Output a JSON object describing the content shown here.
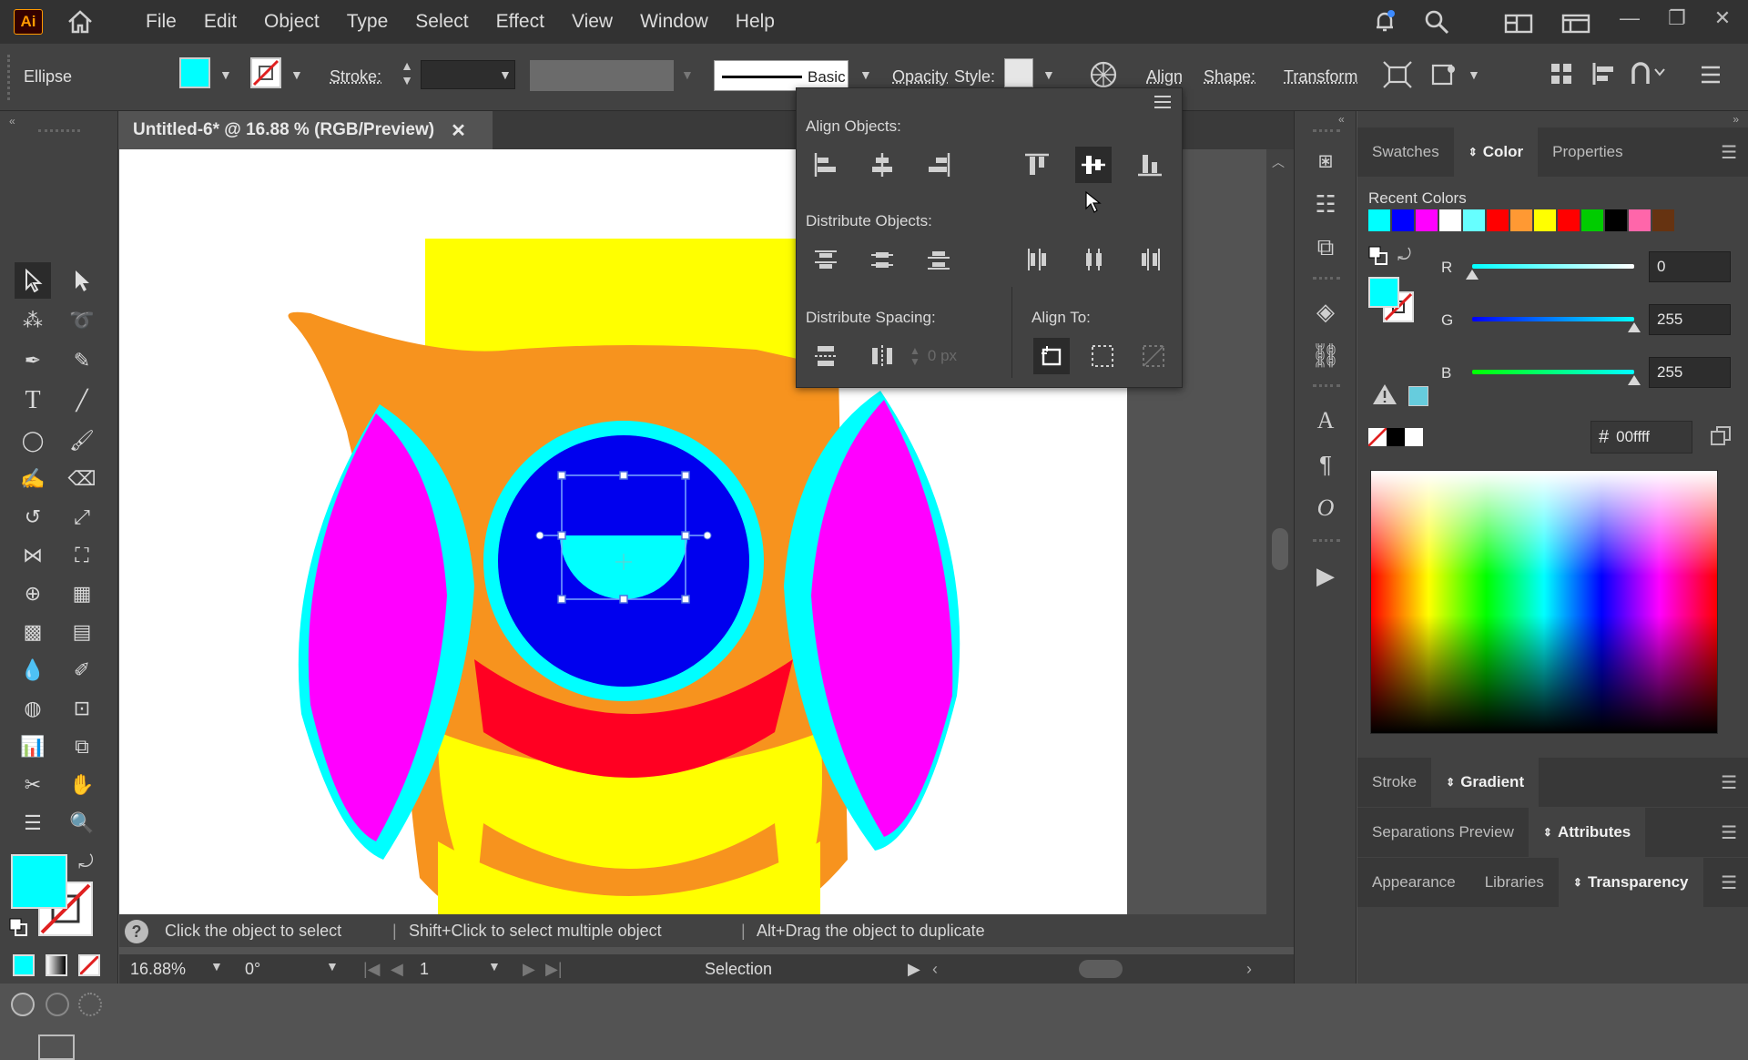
{
  "app": {
    "logo_text": "Ai"
  },
  "menu": [
    "File",
    "Edit",
    "Object",
    "Type",
    "Select",
    "Effect",
    "View",
    "Window",
    "Help"
  ],
  "control_bar": {
    "selection_type": "Ellipse",
    "stroke_label": "Stroke:",
    "brush_label": "Basic",
    "opacity_label": "Opacity",
    "style_label": "Style:",
    "align_label": "Align",
    "shape_label": "Shape:",
    "transform_label": "Transform",
    "fill_color": "#00ffff"
  },
  "document": {
    "tab_title": "Untitled-6* @ 16.88 % (RGB/Preview)",
    "close": "✕"
  },
  "align_panel": {
    "align_objects_label": "Align Objects:",
    "distribute_objects_label": "Distribute Objects:",
    "distribute_spacing_label": "Distribute Spacing:",
    "align_to_label": "Align To:",
    "spacing_value": "0 px"
  },
  "status": {
    "hint_1": "Click the object to select",
    "hint_2": "Shift+Click to select multiple object",
    "hint_3": "Alt+Drag the object to duplicate",
    "zoom": "16.88%",
    "rotation": "0°",
    "artboard": "1",
    "tool": "Selection"
  },
  "color_panel": {
    "tabs": [
      "Swatches",
      "Color",
      "Properties"
    ],
    "active_tab": "Color",
    "recent_colors_label": "Recent Colors",
    "recent_colors": [
      "#00ffff",
      "#0000ff",
      "#ff00ff",
      "#ffffff",
      "#66ffff",
      "#ff0000",
      "#ff9933",
      "#ffff00",
      "#ff0000",
      "#00cc00",
      "#000000",
      "#ff66aa",
      "#663311"
    ],
    "r_label": "R",
    "r_value": "0",
    "r_fraction": 0.0,
    "g_label": "G",
    "g_value": "255",
    "g_fraction": 1.0,
    "b_label": "B",
    "b_value": "255",
    "b_fraction": 1.0,
    "hex_symbol": "#",
    "hex_value": "00ffff"
  },
  "panels": {
    "row1": [
      "Stroke",
      "Gradient"
    ],
    "row1_active": "Gradient",
    "row2": [
      "Separations Preview",
      "Attributes"
    ],
    "row2_active": "Attributes",
    "row3": [
      "Appearance",
      "Libraries",
      "Transparency"
    ],
    "row3_active": "Transparency"
  }
}
